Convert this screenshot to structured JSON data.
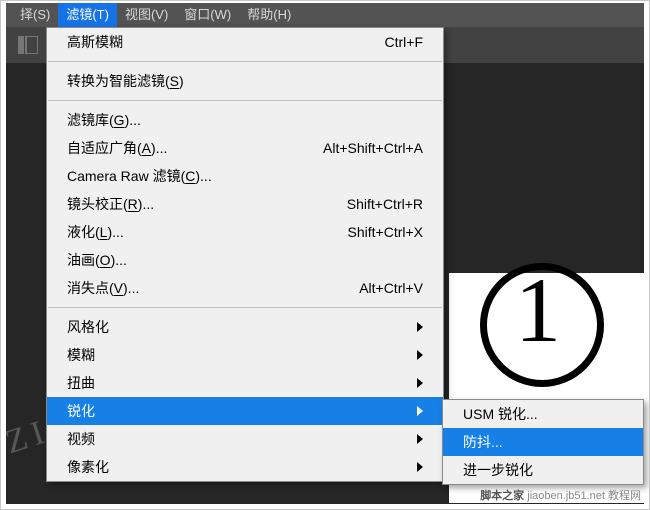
{
  "menubar": {
    "items": [
      {
        "label": "择(S)"
      },
      {
        "label": "滤镜(T)"
      },
      {
        "label": "视图(V)"
      },
      {
        "label": "窗口(W)"
      },
      {
        "label": "帮助(H)"
      }
    ]
  },
  "menu1": {
    "last_filter": {
      "label": "高斯模糊",
      "shortcut": "Ctrl+F"
    },
    "smart": {
      "label": "转换为智能滤镜(",
      "mn": "S",
      "tail": ")"
    },
    "group2": [
      {
        "label": "滤镜库(",
        "mn": "G",
        "tail": ")..."
      },
      {
        "label": "自适应广角(",
        "mn": "A",
        "tail": ")...",
        "shortcut": "Alt+Shift+Ctrl+A"
      },
      {
        "label": "Camera Raw 滤镜(",
        "mn": "C",
        "tail": ")..."
      },
      {
        "label": "镜头校正(",
        "mn": "R",
        "tail": ")...",
        "shortcut": "Shift+Ctrl+R"
      },
      {
        "label": "液化(",
        "mn": "L",
        "tail": ")...",
        "shortcut": "Shift+Ctrl+X"
      },
      {
        "label": "油画(",
        "mn": "O",
        "tail": ")..."
      },
      {
        "label": "消失点(",
        "mn": "V",
        "tail": ")...",
        "shortcut": "Alt+Ctrl+V"
      }
    ],
    "group3": [
      {
        "label": "风格化"
      },
      {
        "label": "模糊"
      },
      {
        "label": "扭曲"
      },
      {
        "label": "锐化"
      },
      {
        "label": "视频"
      },
      {
        "label": "像素化"
      }
    ]
  },
  "menu2": {
    "items": [
      {
        "label": "USM 锐化..."
      },
      {
        "label": "防抖..."
      },
      {
        "label": "进一步锐化"
      }
    ]
  },
  "annotation": {
    "num": "1"
  },
  "watermark": {
    "brand": "脚本之家",
    "url": "jiaoben.jb51.net",
    "suffix": "教程网"
  }
}
